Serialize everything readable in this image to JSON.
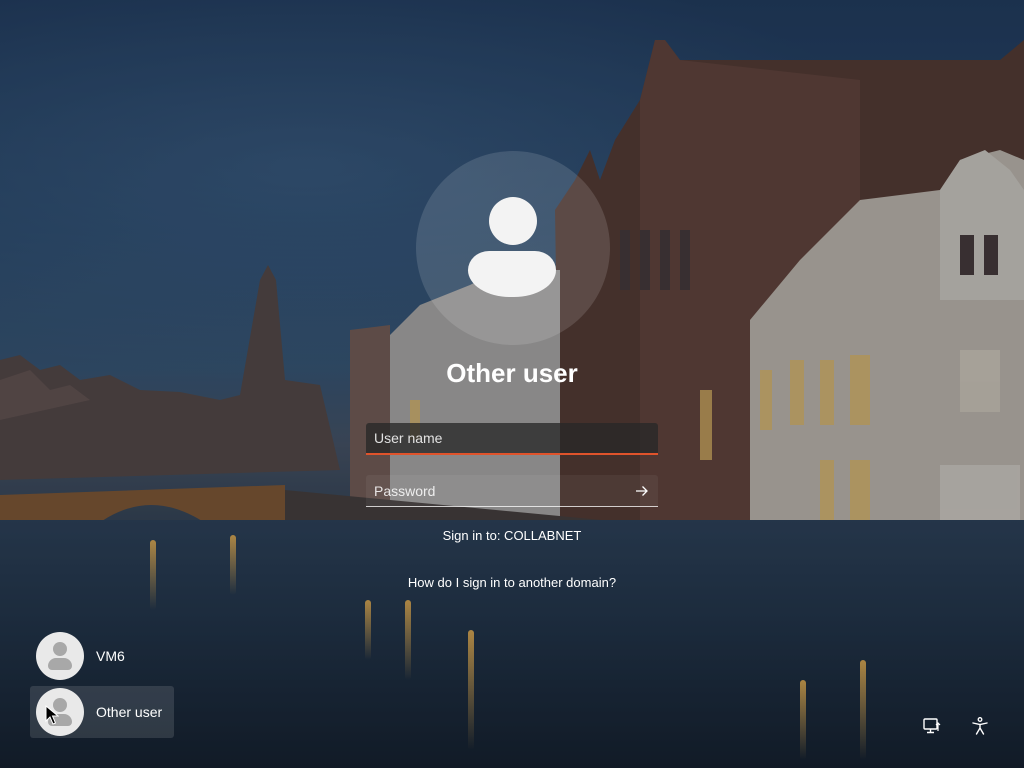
{
  "login": {
    "title": "Other user",
    "username_placeholder": "User name",
    "password_placeholder": "Password",
    "sign_in_to": "Sign in to: COLLABNET",
    "help_link": "How do I sign in to another domain?"
  },
  "users": [
    {
      "name": "VM6",
      "selected": false
    },
    {
      "name": "Other user",
      "selected": true
    }
  ],
  "icons": {
    "submit": "arrow-right-icon",
    "network": "network-icon",
    "accessibility": "accessibility-icon"
  },
  "colors": {
    "accent": "#e0532b"
  }
}
